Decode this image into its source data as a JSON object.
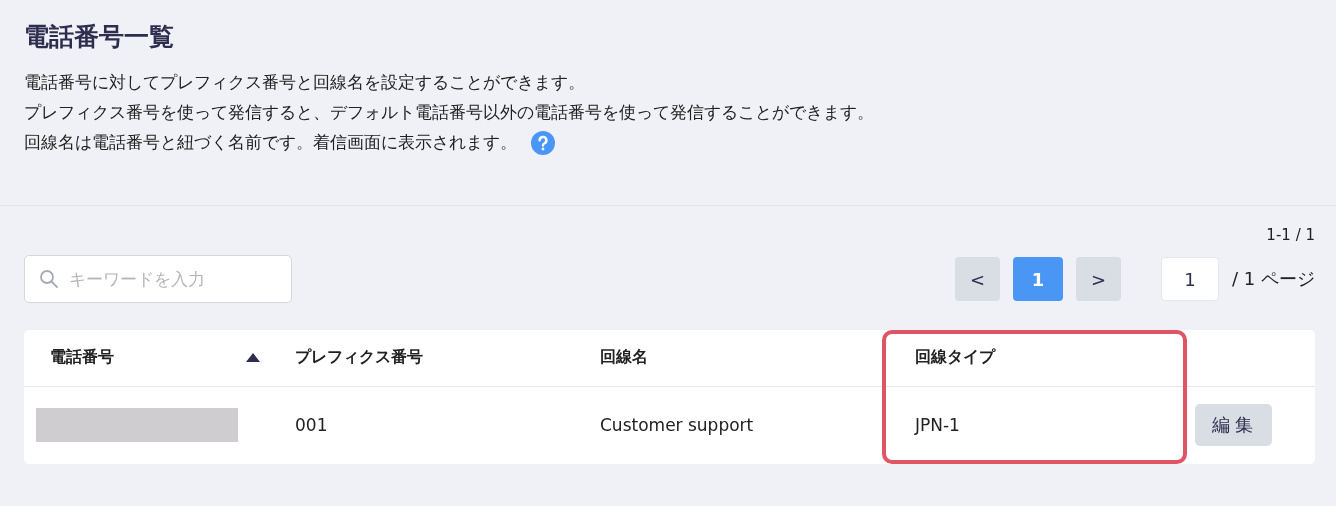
{
  "title": "電話番号一覧",
  "description": [
    "電話番号に対してプレフィクス番号と回線名を設定することができます。",
    "プレフィクス番号を使って発信すると、デフォルト電話番号以外の電話番号を使って発信することができます。",
    "回線名は電話番号と紐づく名前です。着信画面に表示されます。"
  ],
  "search": {
    "placeholder": "キーワードを入力"
  },
  "range": "1-1 / 1",
  "pagination": {
    "prev": "<",
    "pages": [
      {
        "label": "1",
        "selected": true
      }
    ],
    "next": ">",
    "page_input": "1",
    "total": "/ 1 ページ"
  },
  "table": {
    "columns": [
      {
        "label": "電話番号",
        "sorted": true,
        "highlighted": false
      },
      {
        "label": "プレフィクス番号",
        "sorted": false,
        "highlighted": false
      },
      {
        "label": "回線名",
        "sorted": false,
        "highlighted": false
      },
      {
        "label": "回線タイプ",
        "sorted": false,
        "highlighted": true
      }
    ],
    "rows": [
      {
        "phone_redacted": true,
        "prefix": "001",
        "line_name": "Customer support",
        "line_type": "JPN-1",
        "action": "編集"
      }
    ]
  }
}
